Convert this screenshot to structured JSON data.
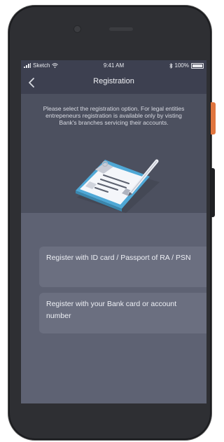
{
  "status_bar": {
    "carrier": "Sketch",
    "time": "9:41 AM",
    "battery": "100%"
  },
  "nav": {
    "title": "Registration",
    "back_icon": "chevron-left-icon"
  },
  "info_text": "Please select the registration option. For legal entities entrepeneurs registration is available only by visting Bank's branches servicing their accounts.",
  "options": [
    {
      "label": "Register with ID card / Passport of RA / PSN"
    },
    {
      "label": "Register with your Bank card or account number"
    }
  ],
  "colors": {
    "screen_bg": "#5e6273",
    "header_bg": "#4c505f",
    "navbar_bg": "#3d4050",
    "option_bg": "#6b6f80",
    "accent_orange": "#e0753e"
  }
}
